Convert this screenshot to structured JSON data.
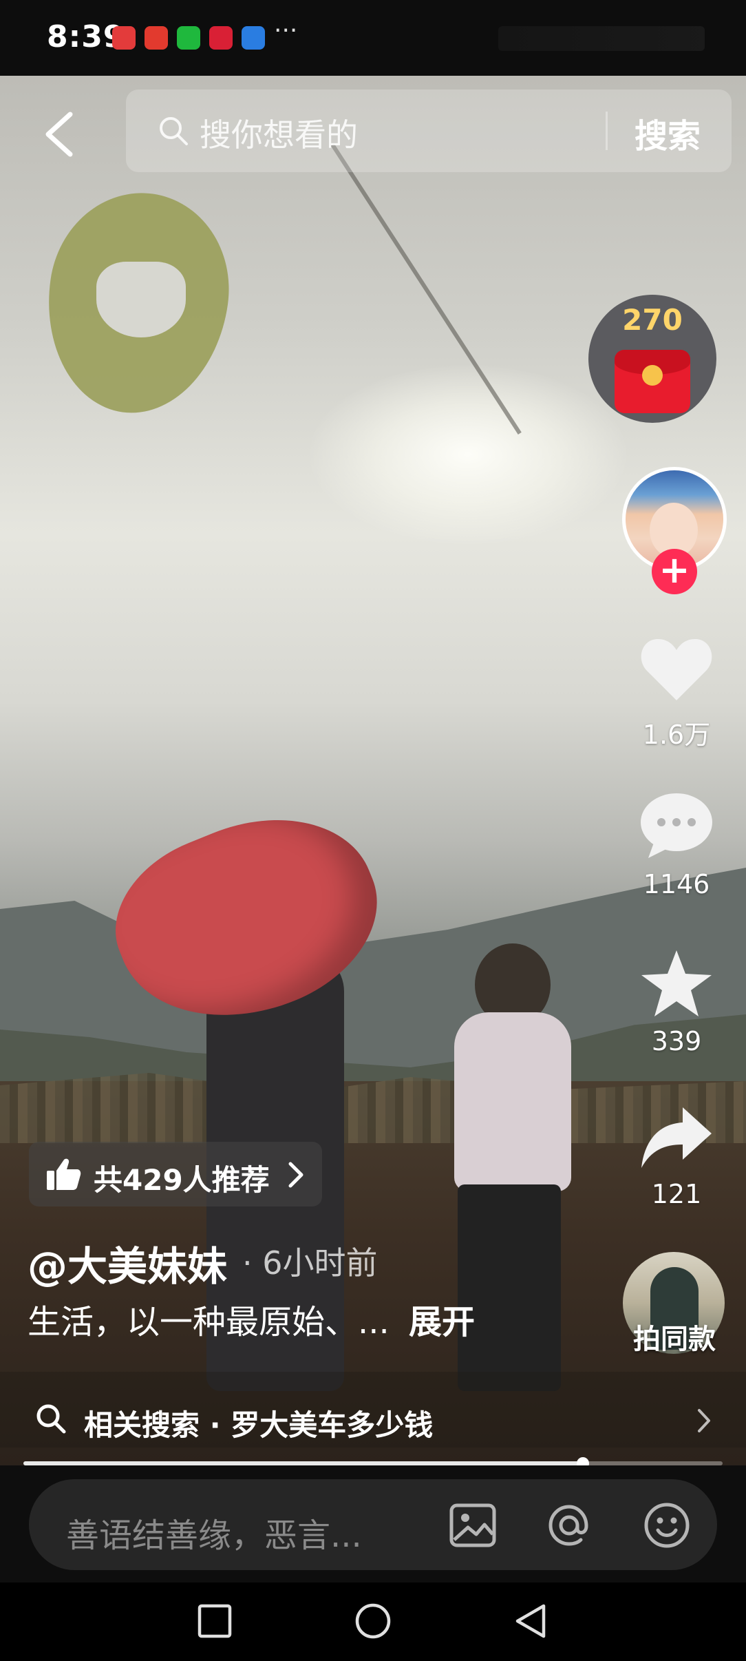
{
  "status_bar": {
    "time": "8:39",
    "more": "···"
  },
  "search": {
    "placeholder": "搜你想看的",
    "button_label": "搜索"
  },
  "right_rail": {
    "red_packet_count": "270",
    "like_count": "1.6万",
    "comment_count": "1146",
    "favorite_count": "339",
    "share_count": "121",
    "same_style_label": "拍同款"
  },
  "post": {
    "recommend_text": "共429人推荐",
    "username": "@大美妹妹",
    "time_ago": "· 6小时前",
    "caption": "生活，以一种最原始、...",
    "expand_label": "展开",
    "related_search": "相关搜索 · 罗大美车多少钱",
    "progress": 0.8
  },
  "comment_bar": {
    "placeholder": "善语结善缘，恶言..."
  },
  "colors": {
    "accent": "#fe2c55",
    "red_packet": "#e81c2d",
    "coin": "#ffd56a"
  }
}
